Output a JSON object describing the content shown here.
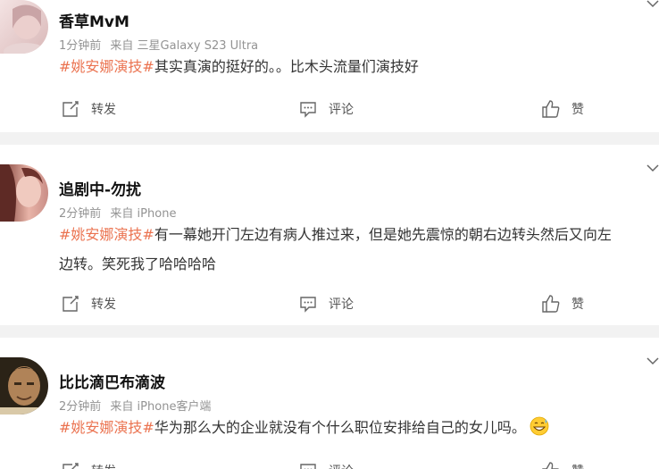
{
  "comments": [
    {
      "username": "香草MvM",
      "time": "1分钟前",
      "source": "来自 三星Galaxy S23 Ultra",
      "topic": "#姚安娜演技#",
      "text": "其实真演的挺好的。。比木头流量们演技好"
    },
    {
      "username": "追剧中-勿扰",
      "time": "2分钟前",
      "source": "来自 iPhone",
      "topic": "#姚安娜演技#",
      "text": "有一幕她开门左边有病人推过来，但是她先震惊的朝右边转头然后又向左",
      "text2": "边转。笑死我了哈哈哈哈"
    },
    {
      "username": "比比滴巴布滴波",
      "time": "2分钟前",
      "source": "来自 iPhone客户端",
      "topic": "#姚安娜演技#",
      "text": "华为那么大的企业就没有个什么职位安排给自己的女儿吗。",
      "emoji": "grin-sweat-emoji"
    }
  ],
  "actions": {
    "repost": "转发",
    "comment": "评论",
    "like": "赞"
  },
  "colors": {
    "topic": "#eb7350",
    "meta": "#939393",
    "separator": "#f2f2f2"
  }
}
